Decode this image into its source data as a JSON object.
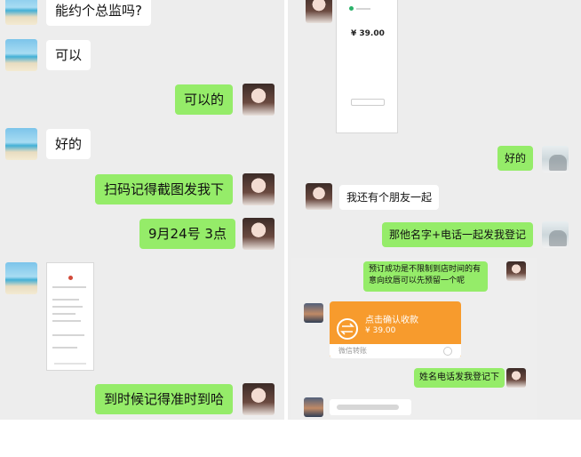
{
  "left_chat": {
    "messages": [
      {
        "side": "them",
        "text": "能约个总监吗?"
      },
      {
        "side": "them",
        "text": "可以"
      },
      {
        "side": "me",
        "text": "可以的"
      },
      {
        "side": "them",
        "text": "好的"
      },
      {
        "side": "me",
        "text": "扫码记得截图发我下"
      },
      {
        "side": "me",
        "text": "9月24号 3点"
      },
      {
        "side": "them",
        "type": "image"
      },
      {
        "side": "me",
        "text": "到时候记得准时到哈"
      }
    ]
  },
  "right_chat": {
    "payment_screenshot": {
      "amount": "¥ 39.00"
    },
    "messages": [
      {
        "side": "me",
        "text": "好的"
      },
      {
        "side": "them",
        "text": "我还有个朋友一起"
      },
      {
        "side": "me",
        "text": "那他名字+电话一起发我登记"
      }
    ]
  },
  "nested_chat": {
    "notice": "预订成功是不限制到店时间的有意向纹唇可以先预留一个呢",
    "transfer": {
      "title": "点击确认收款",
      "amount": "¥ 39.00",
      "footer": "微信转账"
    },
    "request": "姓名电话发我登记下"
  },
  "colors": {
    "green_bubble": "#95ec69",
    "transfer_orange": "#f79b2d",
    "chat_background": "#ededed"
  },
  "icons": [
    "beach-avatar-icon",
    "girl-avatar-icon",
    "group-avatar-icon",
    "sunset-avatar-icon",
    "transfer-icon"
  ]
}
